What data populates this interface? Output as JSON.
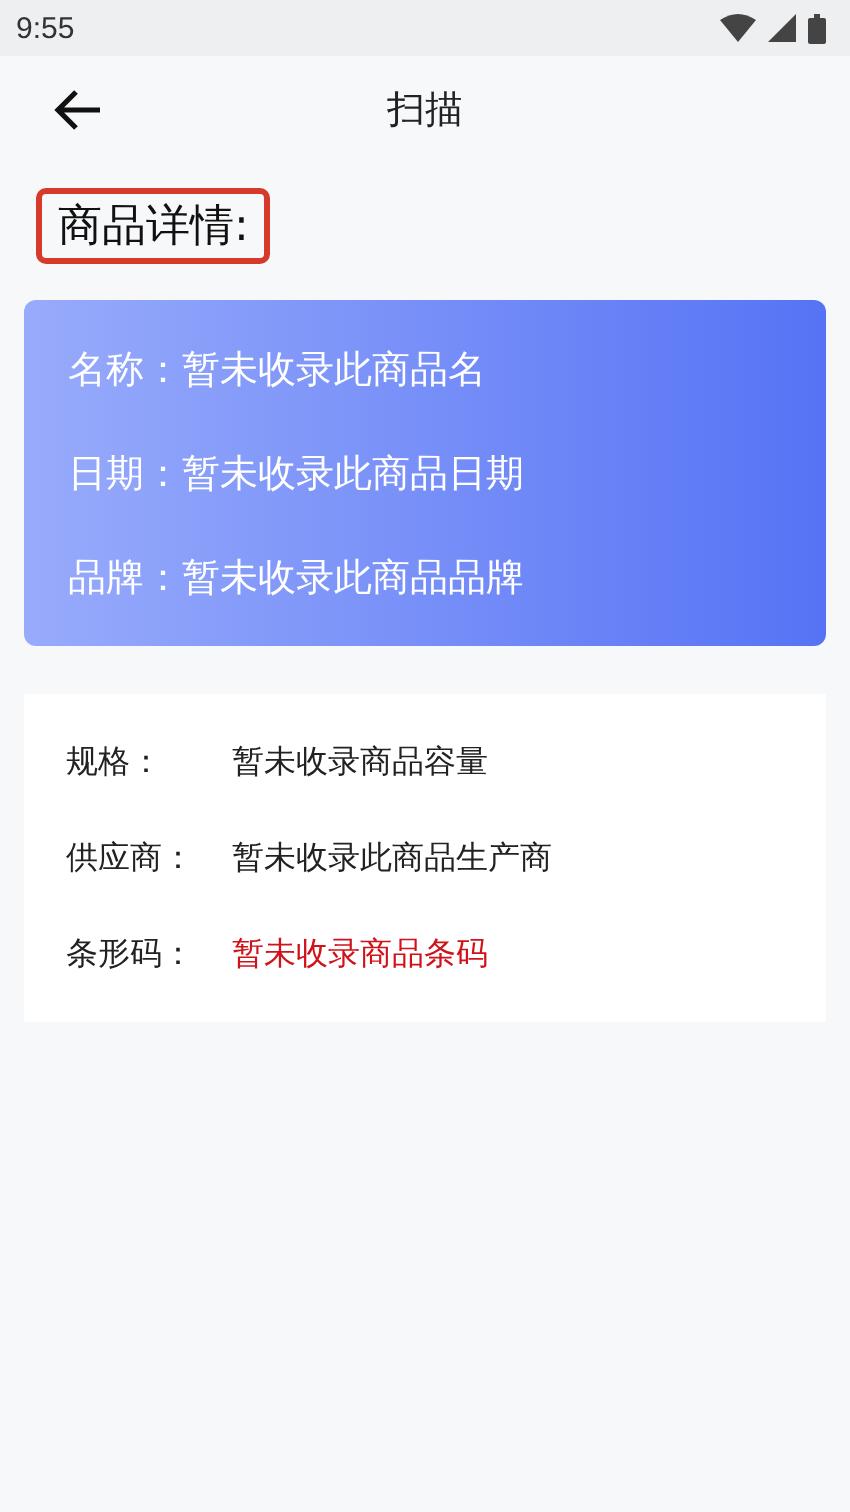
{
  "status_bar": {
    "time": "9:55"
  },
  "header": {
    "title": "扫描"
  },
  "section_label": "商品详情:",
  "summary": [
    {
      "label": "名称：",
      "value": "暂未收录此商品名"
    },
    {
      "label": "日期：",
      "value": "暂未收录此商品日期"
    },
    {
      "label": "品牌：",
      "value": "暂未收录此商品品牌"
    }
  ],
  "details": [
    {
      "label": "规格：",
      "value": "暂未收录商品容量",
      "highlight": false
    },
    {
      "label": "供应商：",
      "value": "暂未收录此商品生产商",
      "highlight": false
    },
    {
      "label": "条形码：",
      "value": "暂未收录商品条码",
      "highlight": true
    }
  ]
}
